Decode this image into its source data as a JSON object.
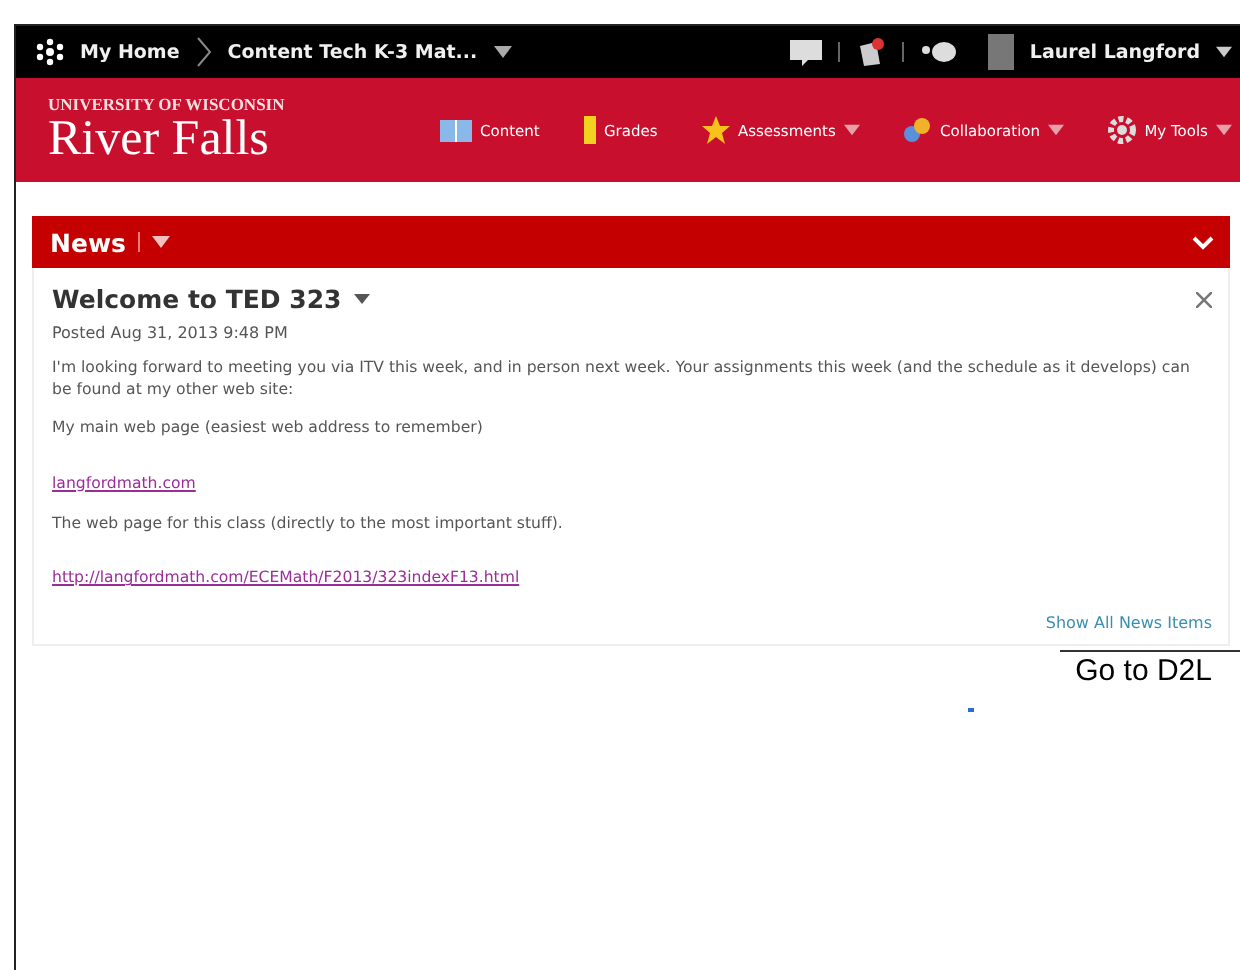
{
  "topbar": {
    "home": "My Home",
    "course": "Content Tech K-3 Mat...",
    "user": "Laurel Langford"
  },
  "header": {
    "university": "UNIVERSITY OF WISCONSIN",
    "campus": "River Falls",
    "nav": [
      {
        "label": "Content",
        "kind": "book",
        "dropdown": false
      },
      {
        "label": "Grades",
        "kind": "bar",
        "dropdown": false
      },
      {
        "label": "Assessments",
        "kind": "star",
        "dropdown": true
      },
      {
        "label": "Collaboration",
        "kind": "people",
        "dropdown": true
      },
      {
        "label": "My Tools",
        "kind": "gear",
        "dropdown": true
      }
    ]
  },
  "widget": {
    "title": "News",
    "item_title": "Welcome to TED 323",
    "posted": "Posted Aug 31, 2013 9:48 PM",
    "body": [
      {
        "kind": "text",
        "text": "I'm looking forward to meeting you via ITV this week, and in person next week.  Your assignments this week (and the schedule as it develops) can be found at my other web site:"
      },
      {
        "kind": "text",
        "text": "My main web page (easiest web address to remember)"
      },
      {
        "kind": "link",
        "text": "langfordmath.com"
      },
      {
        "kind": "text",
        "text": "The web page for this class (directly to the most important stuff)."
      },
      {
        "kind": "link",
        "text": "http://langfordmath.com/ECEMath/F2013/323indexF13.html"
      }
    ],
    "footer_link": "Show All News Items"
  },
  "callout": "Go to D2L"
}
